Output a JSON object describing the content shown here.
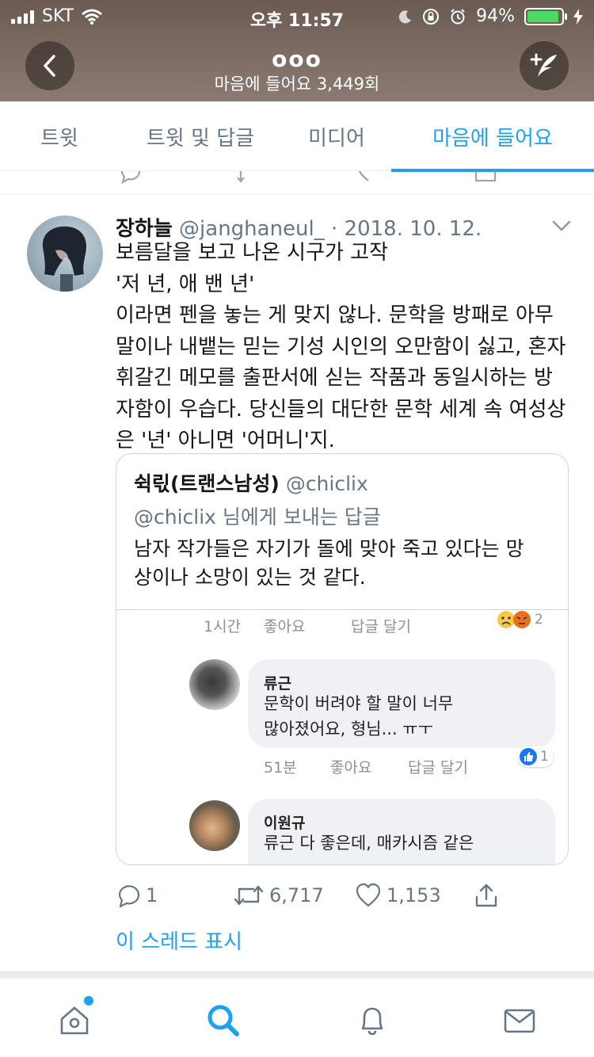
{
  "status_bar": {
    "carrier": "SKT",
    "time": "오후 11:57",
    "battery_percent": "94%",
    "battery_level": 0.94
  },
  "header": {
    "title": "ooo",
    "subtitle": "마음에 들어요 3,449회"
  },
  "tabs": [
    {
      "label": "트윗",
      "active": false
    },
    {
      "label": "트윗 및 답글",
      "active": false
    },
    {
      "label": "미디어",
      "active": false
    },
    {
      "label": "마음에 들어요",
      "active": true
    }
  ],
  "tweet": {
    "author_name": "장하늘",
    "handle_date": "@janghaneul_ · 2018. 10. 12.",
    "text_lines": [
      "보름달을 보고 나온 시구가 고작",
      "'저 년, 애 밴 년'",
      "이라면 펜을 놓는 게 맞지 않나. 문학을 방패로 아무",
      "말이나 내뱉는 믿는 기성 시인의 오만함이 싫고, 혼자",
      "휘갈긴 메모를 출판서에 싣는 작품과 동일시하는 방",
      "자함이 우습다. 당신들의 대단한 문학 세계 속 여성상",
      "은 '년' 아니면 '어머니'지."
    ],
    "quote": {
      "author_name": "쉭릯(트랜스남성)",
      "handle": "@chiclix",
      "reply_to": "@chiclix 님에게 보내는 답글",
      "text_lines": [
        "남자 작가들은 자기가 돌에 맞아 죽고 있다는 망",
        "상이나 소망이 있는 것 같다."
      ],
      "screenshot": {
        "top_meta": {
          "time": "1시간",
          "like": "좋아요",
          "reply": "답글 달기",
          "reaction_count": "2"
        },
        "comment1": {
          "name": "류근",
          "lines": [
            "문학이 버려야 할 말이 너무",
            "많아졌어요, 형님... ㅠㅜ"
          ],
          "time": "51분",
          "like": "좋아요",
          "reply": "답글 달기",
          "reaction_count": "1"
        },
        "comment2": {
          "name": "이원규",
          "lines": [
            "류근  다 좋은데, 매카시즘 같은"
          ]
        }
      }
    },
    "actions": {
      "replies": "1",
      "retweets": "6,717",
      "likes": "1,153"
    },
    "show_thread": "이 스레드 표시"
  },
  "colors": {
    "accent": "#1da1f2",
    "secondary_text": "#657786",
    "header_bg": "#7a6a62",
    "battery_green": "#4cd964"
  },
  "icons": {
    "back": "chevron-left-icon",
    "compose": "compose-feather-icon",
    "reply": "comment-icon",
    "retweet": "retweet-icon",
    "like": "heart-icon",
    "share": "share-icon",
    "nav": [
      "home-icon",
      "search-icon",
      "notifications-bell-icon",
      "messages-envelope-icon"
    ]
  }
}
